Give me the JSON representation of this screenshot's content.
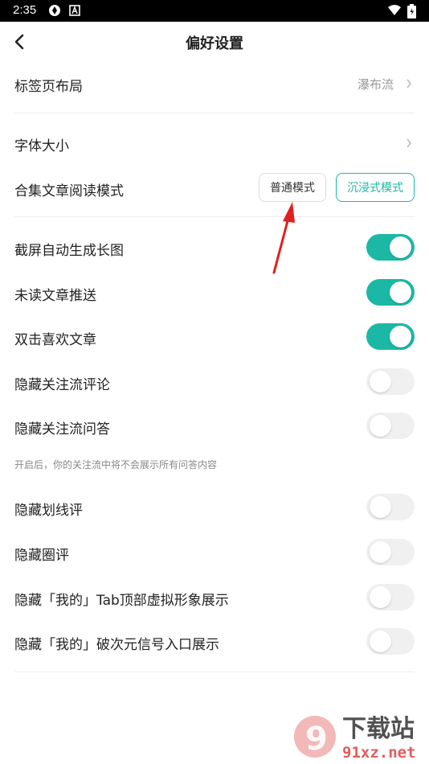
{
  "status_bar": {
    "time": "2:35"
  },
  "header": {
    "title": "偏好设置"
  },
  "settings": {
    "tab_layout": {
      "label": "标签页布局",
      "value": "瀑布流"
    },
    "font_size": {
      "label": "字体大小"
    },
    "collection_reading_mode": {
      "label": "合集文章阅读模式",
      "normal": "普通模式",
      "immersive": "沉浸式模式",
      "selected": "沉浸式模式"
    },
    "toggles": [
      {
        "label": "截屏自动生成长图",
        "on": true
      },
      {
        "label": "未读文章推送",
        "on": true
      },
      {
        "label": "双击喜欢文章",
        "on": true
      },
      {
        "label": "隐藏关注流评论",
        "on": false
      },
      {
        "label": "隐藏关注流问答",
        "on": false
      },
      {
        "label": "隐藏划线评",
        "on": false
      },
      {
        "label": "隐藏圈评",
        "on": false
      },
      {
        "label": "隐藏「我的」Tab顶部虚拟形象展示",
        "on": false
      },
      {
        "label": "隐藏「我的」破次元信号入口展示",
        "on": false
      }
    ],
    "hint": "开启后，你的关注流中将不会展示所有问答内容"
  },
  "watermark": {
    "text": "下载站",
    "domain": "91xz.net",
    "logo_text": "9"
  },
  "colors": {
    "accent": "#1bb8a5",
    "annotation_arrow": "#e02020"
  }
}
